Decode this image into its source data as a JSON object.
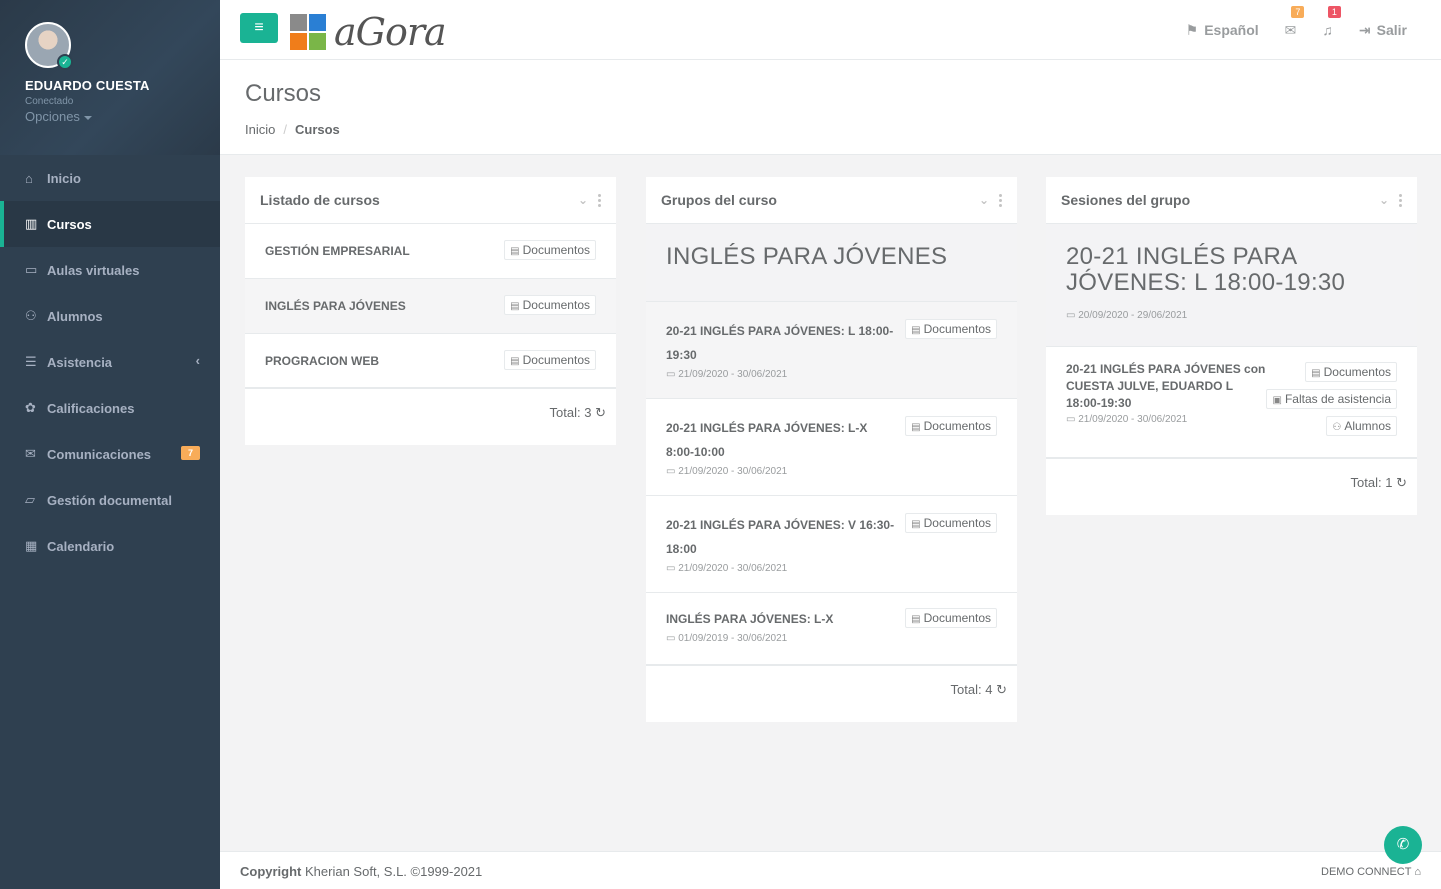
{
  "user": {
    "name": "EDUARDO CUESTA",
    "status": "Conectado",
    "options": "Opciones"
  },
  "sidebar": {
    "items": [
      {
        "label": "Inicio",
        "icon": "home-icon"
      },
      {
        "label": "Cursos",
        "icon": "books-icon"
      },
      {
        "label": "Aulas virtuales",
        "icon": "monitor-icon"
      },
      {
        "label": "Alumnos",
        "icon": "students-icon"
      },
      {
        "label": "Asistencia",
        "icon": "list-icon"
      },
      {
        "label": "Calificaciones",
        "icon": "grades-icon"
      },
      {
        "label": "Comunicaciones",
        "icon": "envelope-icon",
        "badge": "7"
      },
      {
        "label": "Gestión documental",
        "icon": "folder-icon"
      },
      {
        "label": "Calendario",
        "icon": "calendar-icon"
      }
    ]
  },
  "topbar": {
    "logo": "aGora",
    "language": "Español",
    "mail_badge": "7",
    "bell_badge": "1",
    "logout": "Salir"
  },
  "heading": {
    "title": "Cursos",
    "crumb_home": "Inicio",
    "crumb_current": "Cursos"
  },
  "courses": {
    "title": "Listado de cursos",
    "items": [
      {
        "name": "GESTIÓN EMPRESARIAL",
        "button": "Documentos"
      },
      {
        "name": "INGLÉS PARA JÓVENES",
        "button": "Documentos"
      },
      {
        "name": "PROGRACION WEB",
        "button": "Documentos"
      }
    ],
    "total": "Total: 3"
  },
  "groups": {
    "title": "Grupos del curso",
    "banner": "INGLÉS PARA JÓVENES",
    "items": [
      {
        "name": "20-21 INGLÉS PARA JÓVENES: L 18:00-19:30",
        "dates": "21/09/2020 - 30/06/2021",
        "button": "Documentos"
      },
      {
        "name": "20-21 INGLÉS PARA JÓVENES: L-X 8:00-10:00",
        "dates": "21/09/2020 - 30/06/2021",
        "button": "Documentos"
      },
      {
        "name": "20-21 INGLÉS PARA JÓVENES: V 16:30-18:00",
        "dates": "21/09/2020 - 30/06/2021",
        "button": "Documentos"
      },
      {
        "name": "INGLÉS PARA JÓVENES: L-X",
        "dates": "01/09/2019 - 30/06/2021",
        "button": "Documentos"
      }
    ],
    "total": "Total: 4"
  },
  "sessions": {
    "title": "Sesiones del grupo",
    "banner": "20-21 INGLÉS PARA JÓVENES: L 18:00-19:30",
    "banner_dates": "20/09/2020 - 29/06/2021",
    "items": [
      {
        "name": "20-21 INGLÉS PARA JÓVENES con CUESTA JULVE, EDUARDO L 18:00-19:30",
        "dates": "21/09/2020 - 30/06/2021",
        "buttons": [
          "Documentos",
          "Faltas de asistencia",
          "Alumnos"
        ]
      }
    ],
    "total": "Total: 1"
  },
  "footer": {
    "copyright_label": "Copyright",
    "copyright_text": "Kherian Soft, S.L. ©1999-2021",
    "right": "DEMO CONNECT"
  }
}
